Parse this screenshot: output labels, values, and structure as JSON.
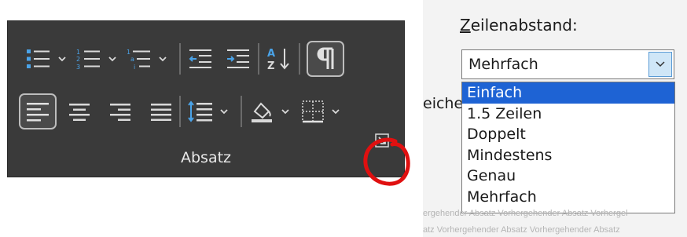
{
  "ribbon": {
    "group_label": "Absatz",
    "icons": [
      "bullets-icon",
      "numbering-icon",
      "multilevel-list-icon",
      "decrease-indent-icon",
      "increase-indent-icon",
      "sort-icon",
      "show-formatting-marks-icon",
      "align-left-icon",
      "center-icon",
      "align-right-icon",
      "justify-icon",
      "line-spacing-icon",
      "shading-icon",
      "borders-icon",
      "dialog-launcher-icon"
    ]
  },
  "dialog": {
    "line_spacing_label_first": "Z",
    "line_spacing_label_rest": "eilenabstand:",
    "combo_value": "Mehrfach",
    "cut_text": "eicher",
    "options": [
      "Einfach",
      "1.5 Zeilen",
      "Doppelt",
      "Mindestens",
      "Genau",
      "Mehrfach"
    ],
    "selected_option": "Einfach",
    "preview_line1": "ergehender Absatz Vorhergehender Absatz Vorhergel",
    "preview_line2": "atz Vorhergehender Absatz Vorhergehender Absatz"
  },
  "colors": {
    "ribbon_bg": "#3a3a3a",
    "icon_blue": "#4aa3e8",
    "icon_light": "#d9d9d9",
    "highlight": "#1e63d4",
    "annotation_red": "#e01010"
  }
}
